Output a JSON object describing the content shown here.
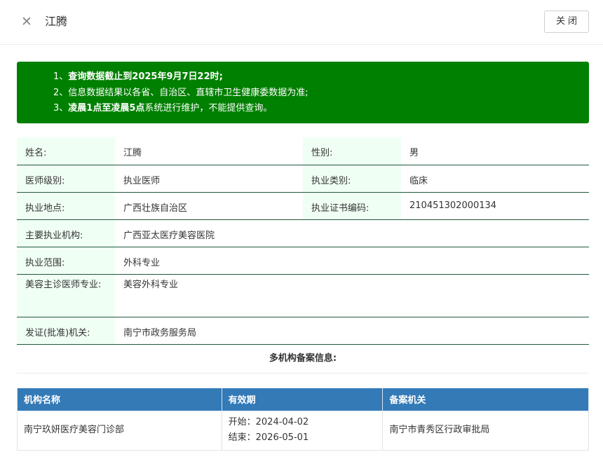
{
  "header": {
    "close_icon": "close-icon",
    "title": "江腾",
    "close_button": "关闭"
  },
  "notice": {
    "line1_prefix": "1、",
    "line1_bold": "查询数据截止到2025年9月7日22时;",
    "line2": "2、信息数据结果以各省、自治区、直辖市卫生健康委数据为准;",
    "line3_prefix": "3、",
    "line3_bold": "凌晨1点至凌晨5点",
    "line3_rest": "系统进行维护，不能提供查询。",
    "bg_color": "#008000"
  },
  "info": {
    "name_label": "姓名:",
    "name_value": "江腾",
    "gender_label": "性别:",
    "gender_value": "男",
    "level_label": "医师级别:",
    "level_value": "执业医师",
    "category_label": "执业类别:",
    "category_value": "临床",
    "location_label": "执业地点:",
    "location_value": "广西壮族自治区",
    "cert_label": "执业证书编码:",
    "cert_value": "210451302000134",
    "institution_label": "主要执业机构:",
    "institution_value": "广西亚太医疗美容医院",
    "scope_label": "执业范围:",
    "scope_value": "外科专业",
    "cosmetic_label": "美容主诊医师专业:",
    "cosmetic_value": "美容外科专业",
    "issuer_label": "发证(批准)机关:",
    "issuer_value": "南宁市政务服务局"
  },
  "multi": {
    "title": "多机构备案信息:",
    "headers": [
      "机构名称",
      "有效期",
      "备案机关"
    ],
    "rows": [
      {
        "name": "南宁玖妍医疗美容门诊部",
        "start": "开始：2024-04-02",
        "end": "结束：2026-05-01",
        "authority": "南宁市青秀区行政审批局"
      }
    ],
    "header_color": "#337ab7"
  }
}
